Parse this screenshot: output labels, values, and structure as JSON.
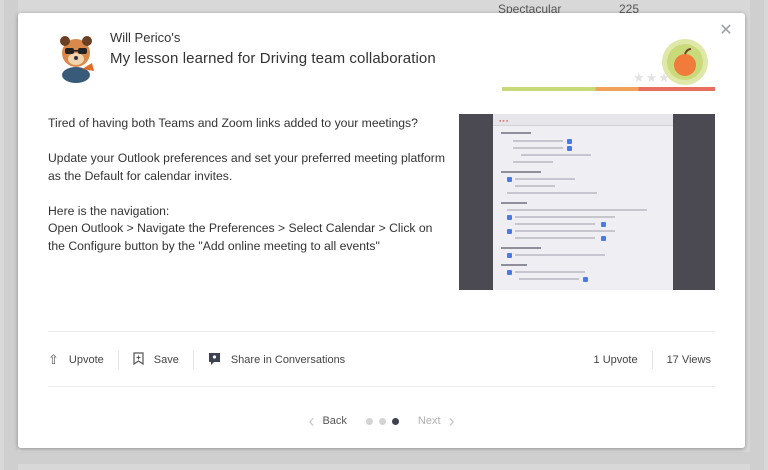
{
  "background": {
    "top_label": "Spectacular",
    "top_count": "225"
  },
  "modal": {
    "author": "Will Perico's",
    "title": "My lesson learned for Driving team collaboration",
    "close_icon": "close-icon",
    "avatar_icon": "avatar-illustration",
    "badge_icon": "apple-badge-icon",
    "body": [
      "Tired of having both Teams and Zoom links added to your meetings?",
      "Update your Outlook preferences and set your preferred meeting platform as the Default for calendar invites.",
      "Here is the navigation:\nOpen Outlook > Navigate the Preferences > Select Calendar > Click on the Configure button by the \"Add online meeting to all events\""
    ]
  },
  "actions": {
    "upvote_label": "Upvote",
    "save_label": "Save",
    "share_label": "Share in Conversations"
  },
  "stats": {
    "upvotes": "1 Upvote",
    "views": "17 Views"
  },
  "pager": {
    "back_label": "Back",
    "next_label": "Next",
    "total": 3,
    "current": 3
  },
  "colors": {
    "accent_active_dot": "#3e4250",
    "progress_green": "#c8d97a",
    "progress_orange": "#f0a259",
    "progress_red": "#e86f5f"
  }
}
